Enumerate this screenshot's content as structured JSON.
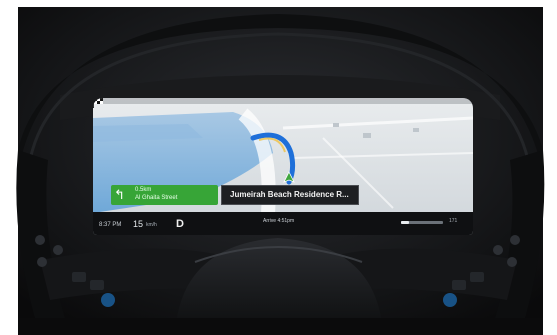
{
  "navigation": {
    "turn_distance": "0.5km",
    "turn_street": "Al Ghaita Street",
    "destination": "Jumeirah Beach Residence R...",
    "eta": "Arrive 4:51pm"
  },
  "status": {
    "time": "8:37 PM",
    "speed_value": "15",
    "speed_unit": "km/h",
    "gear": "D",
    "right_readout": "171"
  },
  "range": {
    "level": 0.2
  },
  "icons": {
    "turn": "turn-left-arrow-icon",
    "destination_flag": "checkered-flag-icon",
    "vehicle": "vehicle-position-arrow-icon"
  },
  "colors": {
    "route": "#1e6fd9",
    "turn_card": "#37a537",
    "water": "#6fa8d8"
  }
}
